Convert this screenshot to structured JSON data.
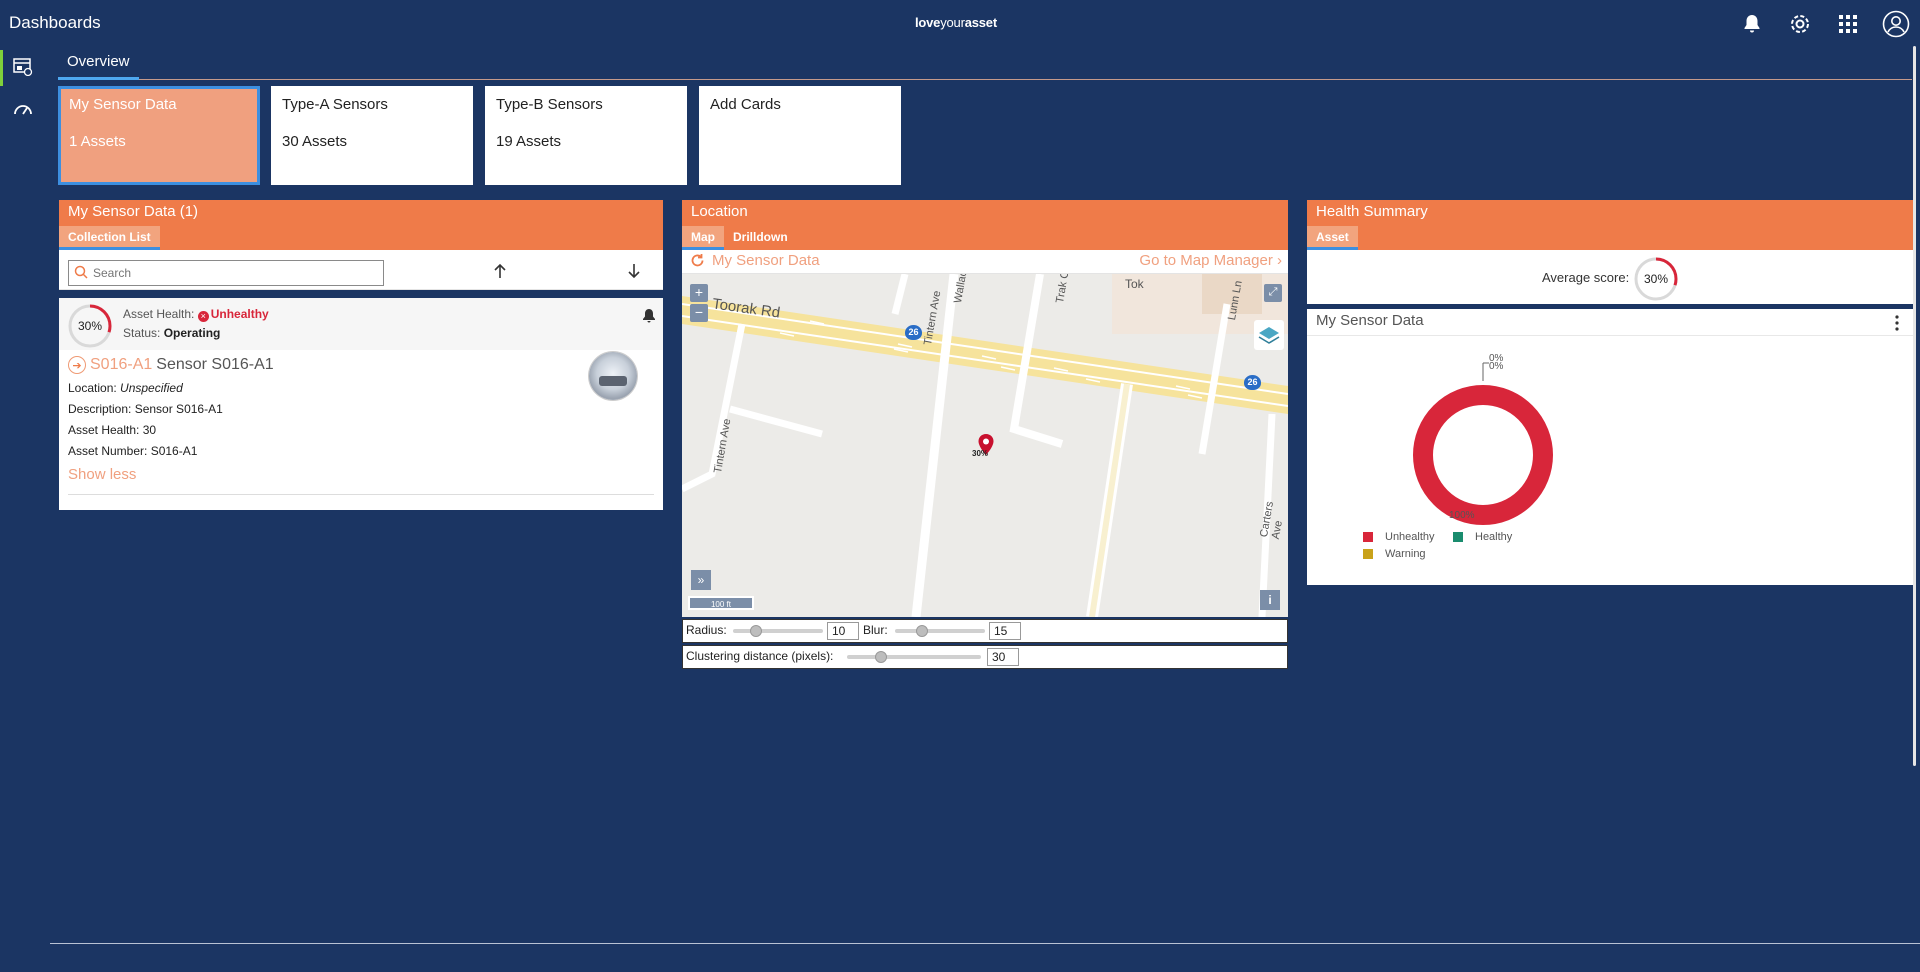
{
  "header": {
    "app_title": "Dashboards",
    "brand_light": "loveyour",
    "brand_bold_prefix": "love",
    "brand_bold_suffix": "asset",
    "icons": [
      "bell-icon",
      "settings-icon",
      "apps-grid-icon",
      "user-profile-icon"
    ]
  },
  "rail": {
    "items": [
      "dashboard-icon",
      "gauge-icon"
    ]
  },
  "tabs": {
    "overview": "Overview"
  },
  "cards": [
    {
      "title": "My Sensor Data",
      "count": "1 Assets",
      "selected": true
    },
    {
      "title": "Type-A Sensors",
      "count": "30 Assets",
      "selected": false
    },
    {
      "title": "Type-B Sensors",
      "count": "19 Assets",
      "selected": false
    },
    {
      "title": "Add Cards",
      "count": "",
      "selected": false
    }
  ],
  "sensor_panel": {
    "title": "My Sensor Data  (1)",
    "tab": "Collection List",
    "search_placeholder": "Search",
    "asset": {
      "score_label": "30%",
      "score_fraction": 0.3,
      "health_label": "Asset Health:",
      "health_value": "Unhealthy",
      "status_label": "Status:",
      "status_value": "Operating",
      "id": "S016-A1",
      "name": "Sensor S016-A1",
      "location_label": "Location:",
      "location_value": "Unspecified",
      "description_label": "Description:",
      "description_value": "Sensor S016-A1",
      "health_num_label": "Asset Health:",
      "health_num_value": "30",
      "number_label": "Asset Number:",
      "number_value": "S016-A1",
      "show_less": "Show less"
    }
  },
  "location_panel": {
    "title": "Location",
    "tabs": [
      "Map",
      "Drilldown"
    ],
    "collection": "My Sensor Data",
    "goto": "Go to Map Manager",
    "map": {
      "streets": [
        "Toorak Rd",
        "Wallace Ave",
        "Trak Centre",
        "Lunn Ln",
        "Tintern Ave",
        "Tintern Ave",
        "Carters Ave"
      ],
      "poi": "Tok",
      "route_badge": "26",
      "marker_label": "30%",
      "scale": "100 ft",
      "zoom_in": "+",
      "zoom_out": "−",
      "info": "i",
      "expand": "»"
    },
    "radius_label": "Radius:",
    "radius_value": "10",
    "blur_label": "Blur:",
    "blur_value": "15",
    "cluster_label": "Clustering distance (pixels):",
    "cluster_value": "30",
    "radius_fraction": 0.25,
    "blur_fraction": 0.3,
    "cluster_fraction": 0.25
  },
  "health_panel": {
    "title": "Health Summary",
    "tab": "Asset",
    "avg_label": "Average score:",
    "avg_value": "30%",
    "avg_fraction": 0.3,
    "card_title": "My Sensor Data",
    "donut_labels": {
      "top1": "0%",
      "top2": "0%",
      "bottom": "100%"
    },
    "legend": [
      {
        "label": "Unhealthy",
        "color": "#d8263a"
      },
      {
        "label": "Healthy",
        "color": "#1a8c6e"
      },
      {
        "label": "Warning",
        "color": "#c9a21a"
      }
    ],
    "donut_values": {
      "Unhealthy": 100,
      "Healthy": 0,
      "Warning": 0
    }
  },
  "colors": {
    "accent": "#ef7b49",
    "background": "#1b3563",
    "unhealthy": "#d8263a"
  }
}
